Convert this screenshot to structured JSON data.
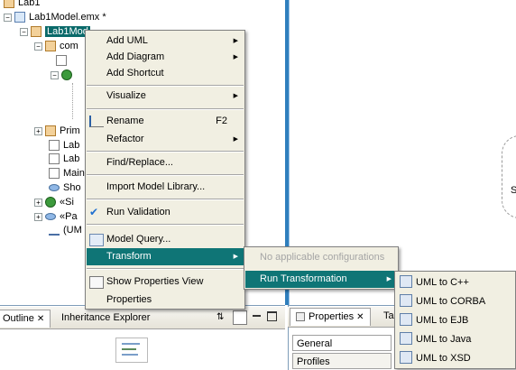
{
  "tree": {
    "root_label": "Lab1",
    "model_file": "Lab1Model.emx *",
    "selected_model": "Lab1Mod",
    "items": [
      "com",
      "Prim",
      "Lab",
      "Lab",
      "Main",
      "Sho",
      "«Si",
      "«Pa",
      "(UM"
    ]
  },
  "diagram": {
    "partial_label": "S"
  },
  "context_menu": {
    "items": [
      {
        "label": "Add UML",
        "submenu": true
      },
      {
        "label": "Add Diagram",
        "submenu": true
      },
      {
        "label": "Add Shortcut"
      },
      {
        "label": "Visualize",
        "submenu": true
      },
      {
        "label": "Rename",
        "accel": "F2",
        "icon": "rename-icon"
      },
      {
        "label": "Refactor",
        "submenu": true
      },
      {
        "label": "Find/Replace..."
      },
      {
        "label": "Import Model Library..."
      },
      {
        "label": "Run Validation",
        "icon": "validation-icon"
      },
      {
        "label": "Model Query...",
        "icon": "query-icon"
      },
      {
        "label": "Transform",
        "submenu": true,
        "highlighted": true
      },
      {
        "label": "Show Properties View",
        "icon": "properties-icon"
      },
      {
        "label": "Properties"
      }
    ]
  },
  "transform_menu": {
    "items": [
      {
        "label": "No applicable configurations",
        "disabled": true
      },
      {
        "label": "Run Transformation",
        "submenu": true,
        "highlighted": true
      }
    ]
  },
  "run_transformation_menu": {
    "items": [
      "UML to C++",
      "UML to CORBA",
      "UML to EJB",
      "UML to Java",
      "UML to XSD"
    ]
  },
  "bottom_left_tabs": {
    "outline": "Outline",
    "inheritance": "Inheritance Explorer"
  },
  "properties_view": {
    "tab": "Properties",
    "tab2": "Ta",
    "sections": [
      "General",
      "Profiles"
    ]
  },
  "colors": {
    "highlight": "#0f7576",
    "menu_bg": "#f1efe2",
    "separator_blue": "#2f7fbd"
  }
}
